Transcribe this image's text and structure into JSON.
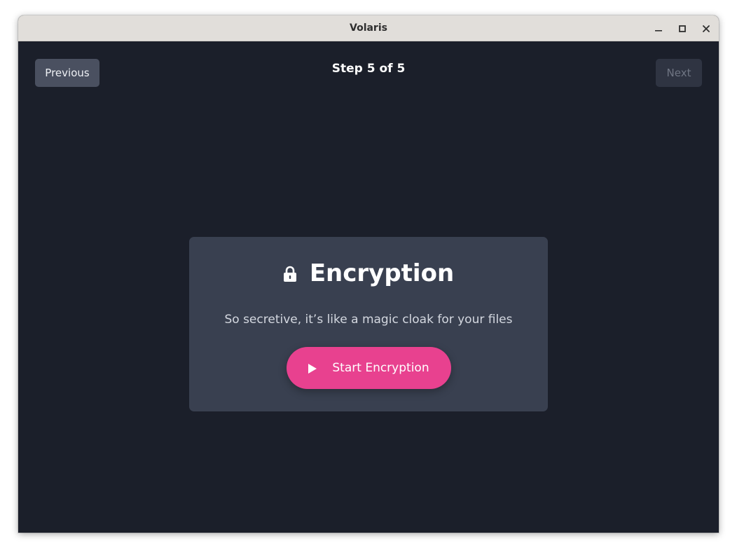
{
  "window": {
    "title": "Volaris"
  },
  "navigation": {
    "previous_label": "Previous",
    "next_label": "Next",
    "step_label": "Step 5 of 5"
  },
  "card": {
    "icon": "lock-icon",
    "title": "Encryption",
    "description": "So secretive, it’s like a magic cloak for your files",
    "action": {
      "icon": "play-icon",
      "label": "Start Encryption"
    }
  },
  "colors": {
    "background": "#1b1f2a",
    "card": "#394050",
    "accent": "#e8418f",
    "titlebar": "#e1deda"
  }
}
